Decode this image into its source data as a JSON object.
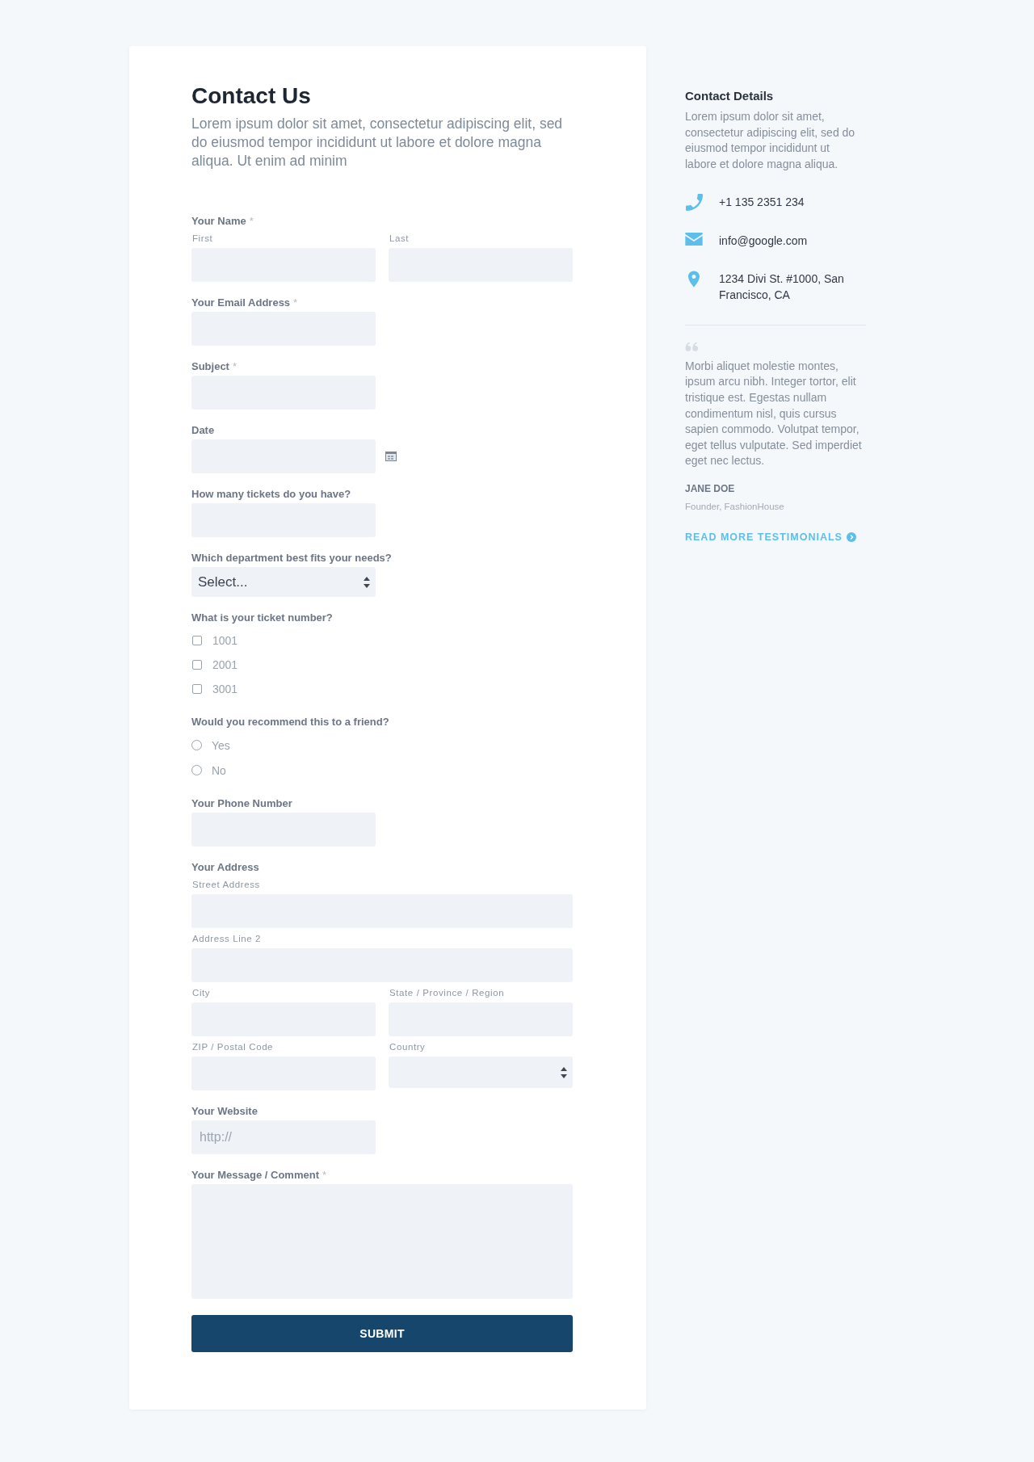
{
  "form": {
    "title": "Contact Us",
    "intro": "Lorem ipsum dolor sit amet, consectetur adipiscing elit, sed do eiusmod tempor incididunt ut labore et dolore magna aliqua. Ut enim ad minim",
    "fields": [
      {
        "kind": "multi",
        "label": "Your Name",
        "required_mark": "*",
        "rows": [
          {
            "parts": [
              {
                "kind": "text",
                "sublabel": "First"
              },
              {
                "kind": "text",
                "sublabel": "Last"
              }
            ]
          }
        ]
      },
      {
        "kind": "text",
        "label": "Your Email Address",
        "required_mark": "*"
      },
      {
        "kind": "text",
        "label": "Subject",
        "required_mark": "*"
      },
      {
        "kind": "date",
        "label": "Date"
      },
      {
        "kind": "text",
        "label": "How many tickets do you have?"
      },
      {
        "kind": "select",
        "label": "Which department best fits your needs?",
        "value": "Select..."
      },
      {
        "kind": "checkboxes",
        "label": "What is your ticket number?",
        "options": [
          {
            "label": "1001",
            "checked": false
          },
          {
            "label": "2001",
            "checked": false
          },
          {
            "label": "3001",
            "checked": false
          }
        ]
      },
      {
        "kind": "radios",
        "label": "Would you recommend this to a friend?",
        "options": [
          {
            "label": "Yes",
            "selected": false
          },
          {
            "label": "No",
            "selected": false
          }
        ]
      },
      {
        "kind": "text",
        "label": "Your Phone Number"
      },
      {
        "kind": "multi",
        "label": "Your Address",
        "rows": [
          {
            "parts": [
              {
                "kind": "text",
                "sublabel": "Street Address"
              }
            ]
          },
          {
            "parts": [
              {
                "kind": "text",
                "sublabel": "Address Line 2"
              }
            ]
          },
          {
            "parts": [
              {
                "kind": "text",
                "sublabel": "City"
              },
              {
                "kind": "text",
                "sublabel": "State / Province / Region"
              }
            ]
          },
          {
            "parts": [
              {
                "kind": "text",
                "sublabel": "ZIP / Postal Code"
              },
              {
                "kind": "select",
                "sublabel": "Country"
              }
            ]
          }
        ]
      },
      {
        "kind": "text",
        "label": "Your Website",
        "placeholder": "http://"
      },
      {
        "kind": "textarea",
        "label": "Your Message / Comment",
        "required_mark": "*"
      }
    ],
    "submit": "SUBMIT"
  },
  "sidebar": {
    "title": "Contact Details",
    "text": "Lorem ipsum dolor sit amet, consectetur adipiscing elit, sed do eiusmod tempor incididunt ut labore et dolore magna aliqua.",
    "contacts": [
      {
        "kind": "phone",
        "text": "+1 135 2351 234"
      },
      {
        "kind": "email",
        "text": "info@google.com"
      },
      {
        "kind": "location",
        "text": "1234 Divi St. #1000, San Francisco, CA"
      }
    ],
    "testimonial": {
      "quote": "Morbi aliquet molestie montes, ipsum arcu nibh. Integer tortor, elit tristique est. Egestas nullam condimentum nisl, quis cursus sapien commodo. Volutpat tempor, eget tellus vulputate. Sed imperdiet eget nec lectus.",
      "author": "JANE DOE",
      "role": "Founder, FashionHouse"
    },
    "link": "READ MORE TESTIMONIALS"
  }
}
